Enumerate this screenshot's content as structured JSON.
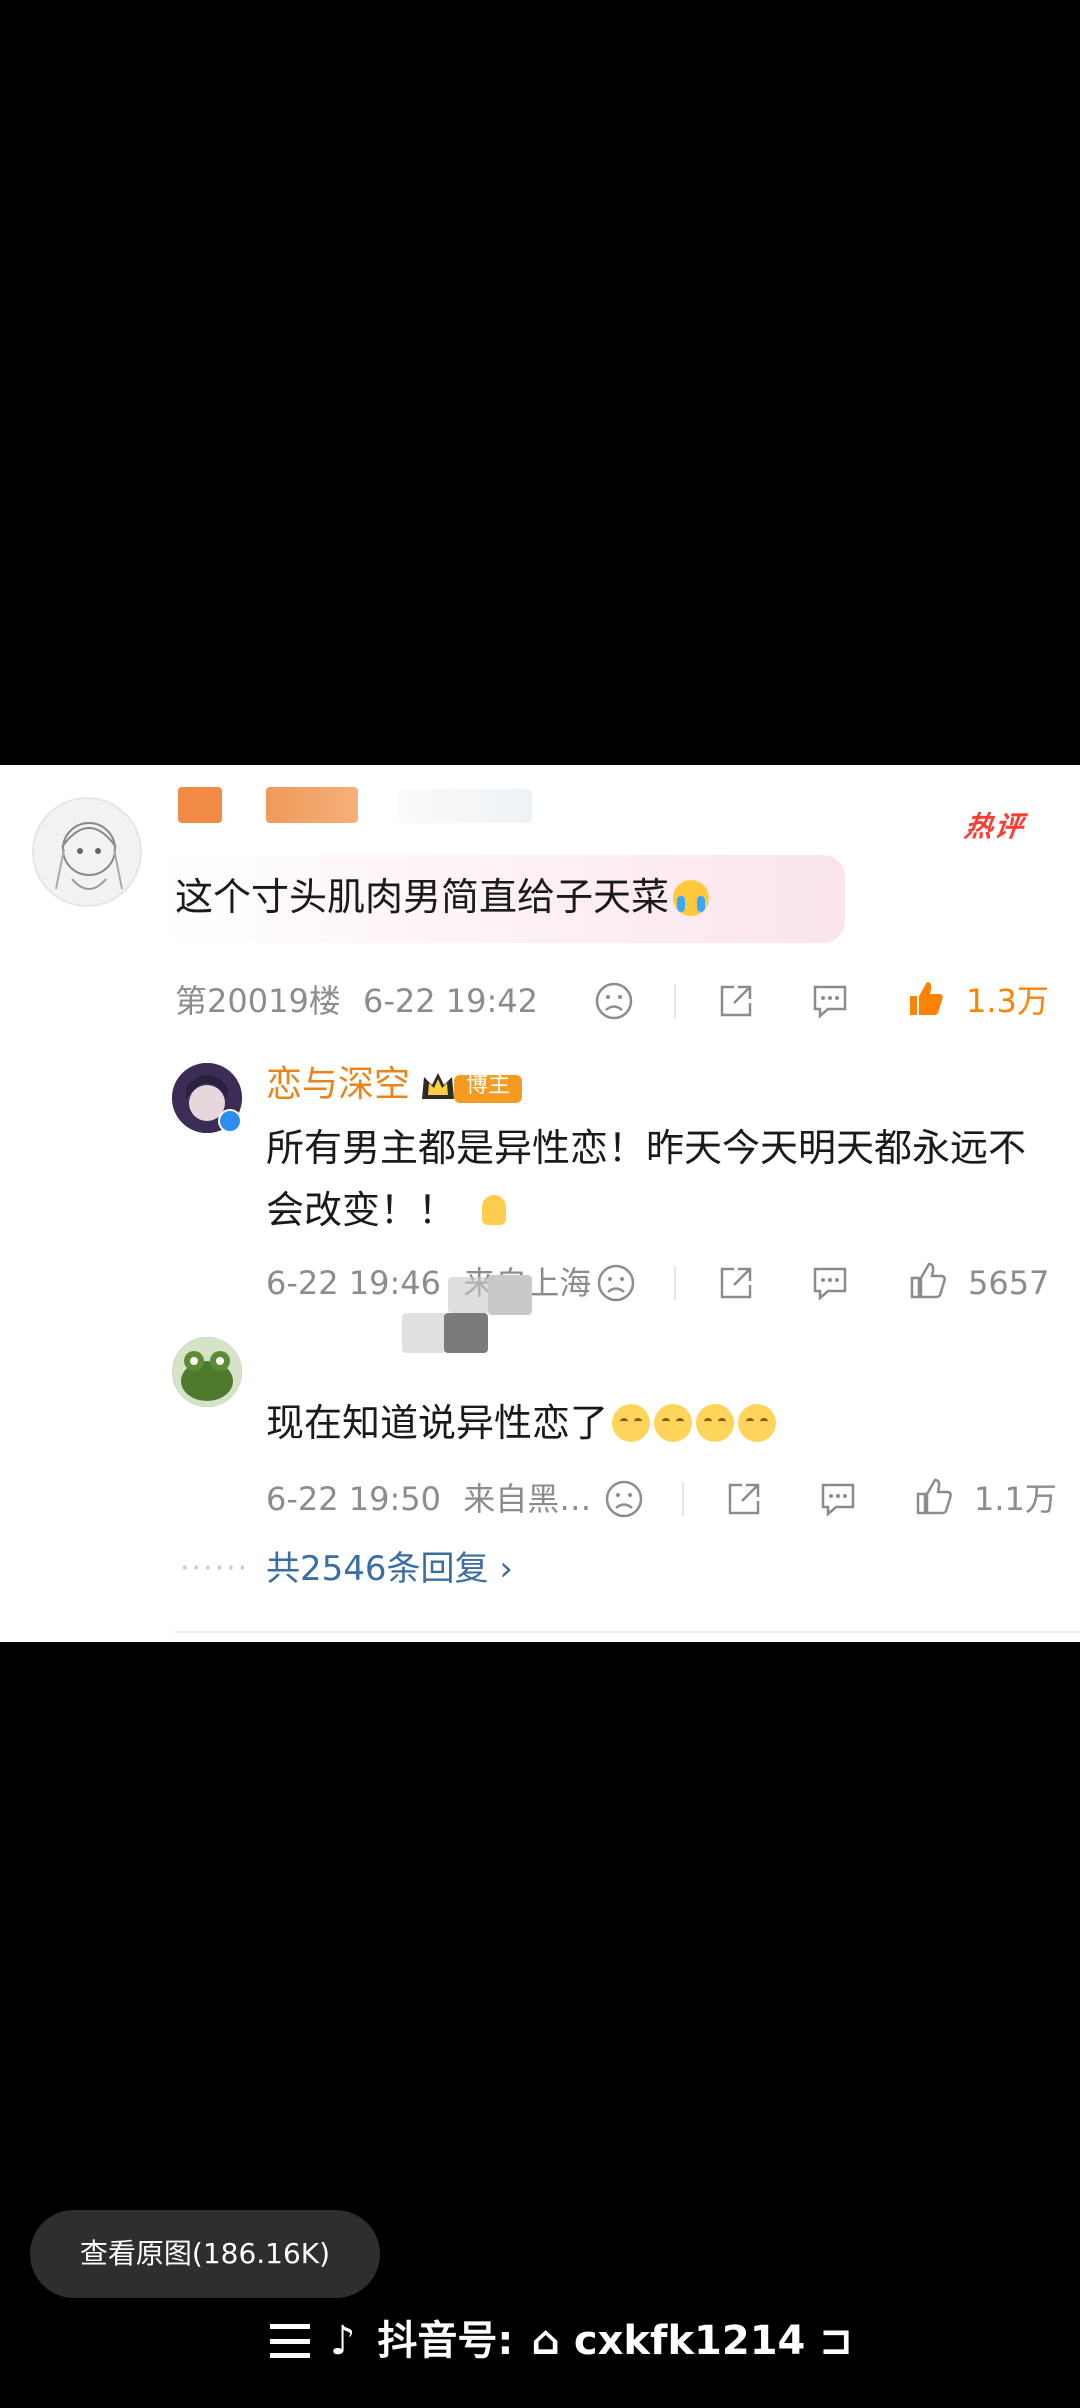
{
  "post": {
    "hot_label": "热评",
    "comment_text": "这个寸头肌肉男简直给子天菜",
    "floor": "第20019楼",
    "time": "6-22 19:42",
    "likes": "1.3万",
    "like_color": "#ff8200"
  },
  "replies": [
    {
      "name": "恋与深空",
      "badge": "博主",
      "text": "所有男主都是异性恋！昨天今天明天都永远不会改变！！",
      "time": "6-22 19:46",
      "location": "来自上海",
      "likes": "5657"
    },
    {
      "text": "现在知道说异性恋了",
      "time": "6-22 19:50",
      "location": "来自黑…",
      "likes": "1.1万"
    }
  ],
  "more_replies": "共2546条回复 ›",
  "viewer": {
    "view_original": "查看原图(186.16K)"
  },
  "watermark": {
    "text": "抖音号:",
    "id": "cxkfk1214"
  },
  "colors": {
    "accent": "#ff8200",
    "link": "#3a6ea5",
    "hot": "#ff3b30",
    "name": "#e8851a"
  }
}
